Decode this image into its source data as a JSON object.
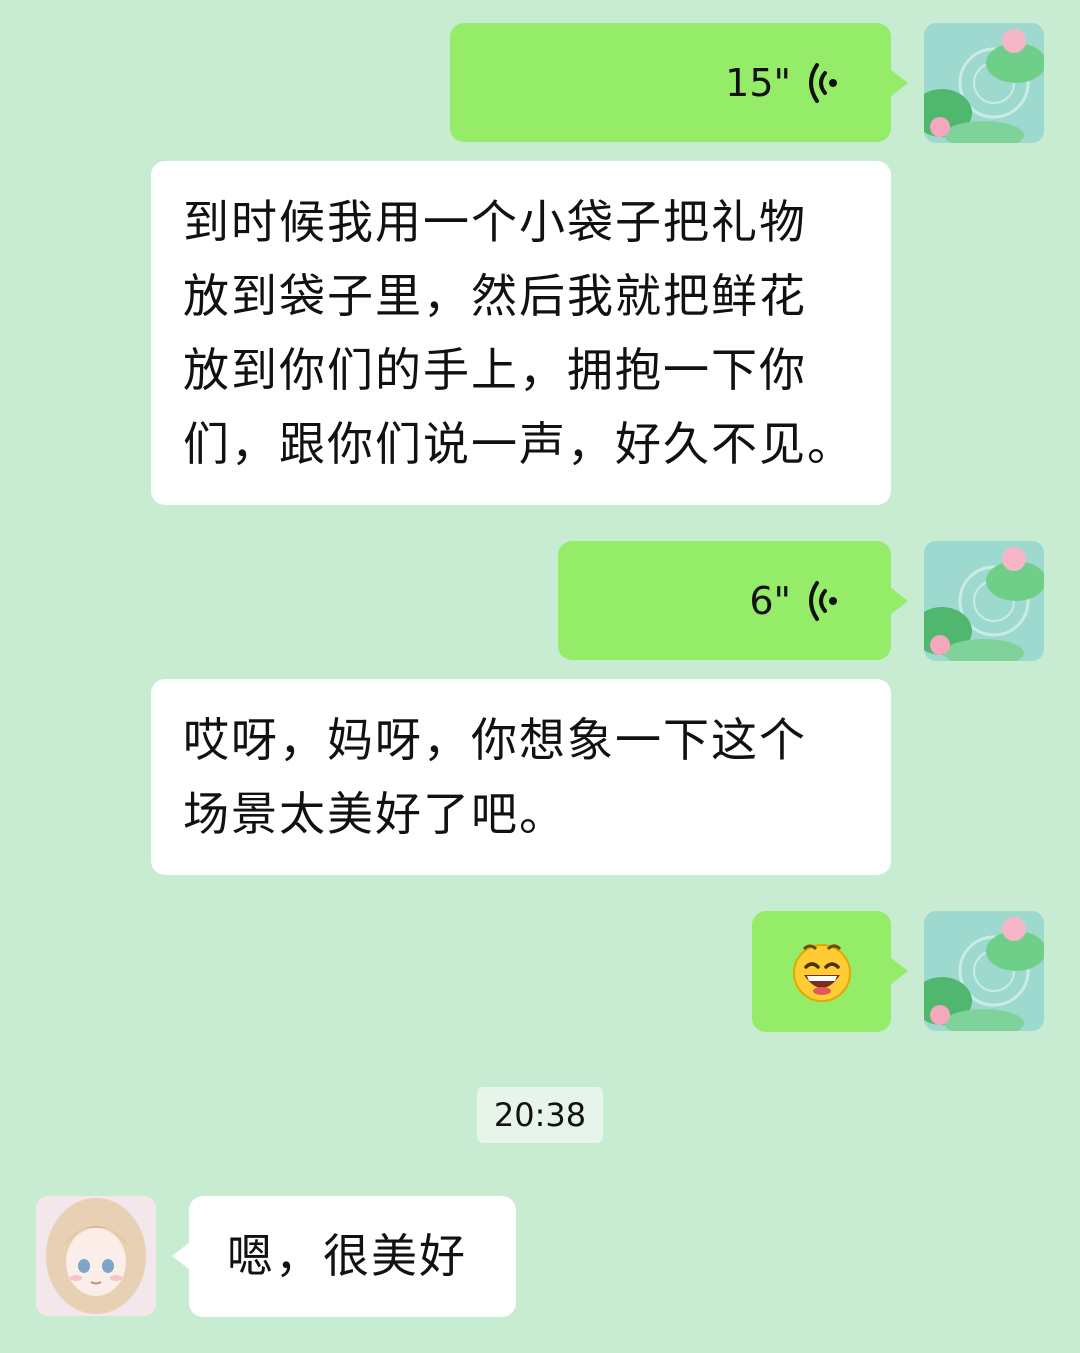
{
  "messages": [
    {
      "side": "right",
      "type": "voice",
      "duration": "15\""
    },
    {
      "side": "right",
      "type": "text",
      "text": "到时候我用一个小袋子把礼物\n放到袋子里，然后我就把鲜花\n放到你们的手上，拥抱一下你\n们，跟你们说一声，好久不见。"
    },
    {
      "side": "right",
      "type": "voice",
      "duration": "6\""
    },
    {
      "side": "right",
      "type": "text",
      "text": "哎呀，妈呀，你想象一下这个\n场景太美好了吧。"
    },
    {
      "side": "right",
      "type": "emoji",
      "emoji": "grinning-face-emoji"
    },
    {
      "side": "left",
      "type": "text",
      "text": "嗯，很美好"
    }
  ],
  "timestamp": "20:38",
  "colors": {
    "background": "#c8ecd2",
    "sent_bubble": "#95ec69",
    "received_bubble": "#ffffff",
    "voice_icon": "#111111"
  },
  "avatars": {
    "self": "lotus-pond-avatar",
    "other": "anime-girl-avatar"
  }
}
